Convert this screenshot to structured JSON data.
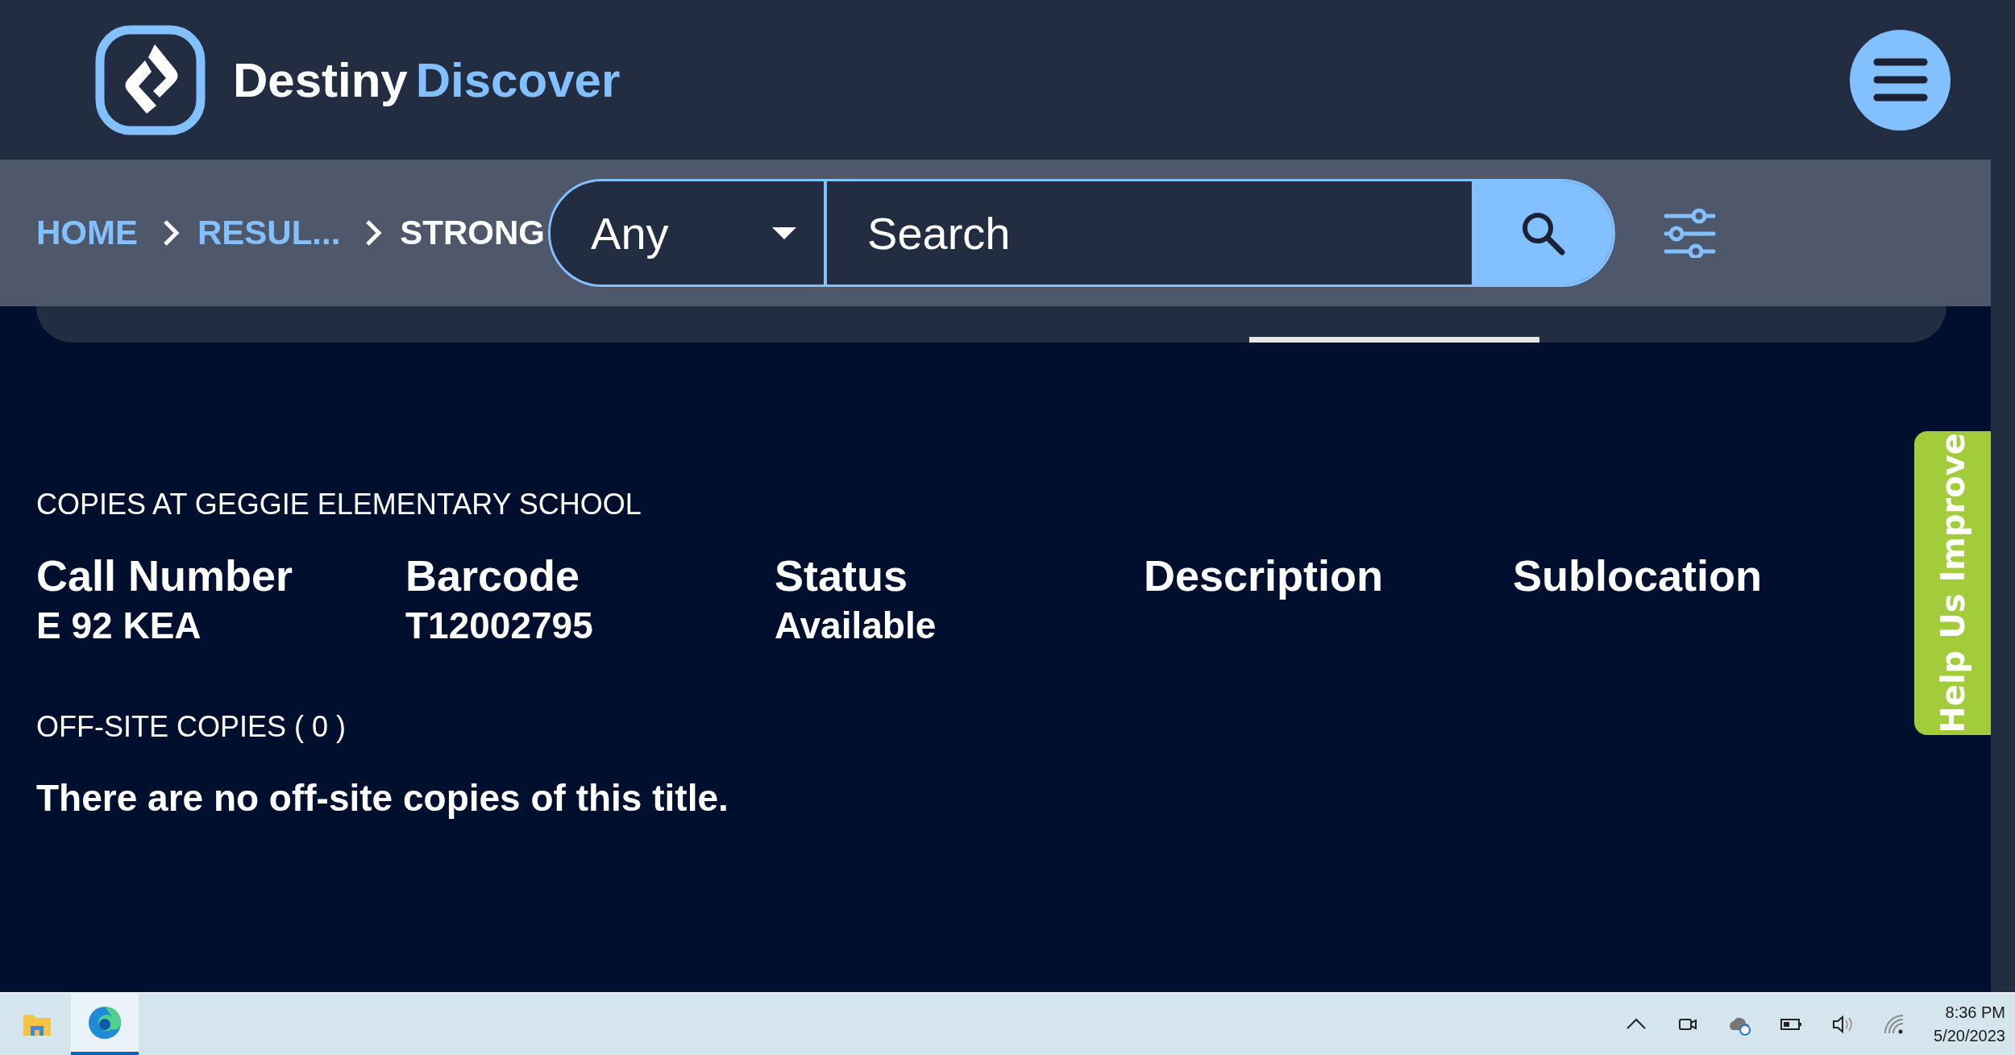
{
  "header": {
    "brand": [
      "Destiny",
      "Discover"
    ]
  },
  "breadcrumbs": [
    {
      "label": "HOME",
      "selected": false
    },
    {
      "label": "RESUL...",
      "selected": false
    },
    {
      "label": "STRONG",
      "selected": true
    }
  ],
  "search": {
    "scope": "Any",
    "placeholder": "Search"
  },
  "copies": {
    "title": "COPIES AT GEGGIE ELEMENTARY SCHOOL",
    "columns": [
      {
        "heading": "Call Number",
        "value": "E 92 KEA"
      },
      {
        "heading": "Barcode",
        "value": "T12002795"
      },
      {
        "heading": "Status",
        "value": "Available"
      },
      {
        "heading": "Description"
      },
      {
        "heading": "Sublocation"
      }
    ]
  },
  "offsite": {
    "title": "OFF-SITE COPIES ( 0 )",
    "message": "There are no off-site copies of this title."
  },
  "feedback_tab": {
    "label": "Help Us Improve"
  },
  "taskbar": {
    "time": "8:36 PM",
    "date": "5/20/2023"
  }
}
